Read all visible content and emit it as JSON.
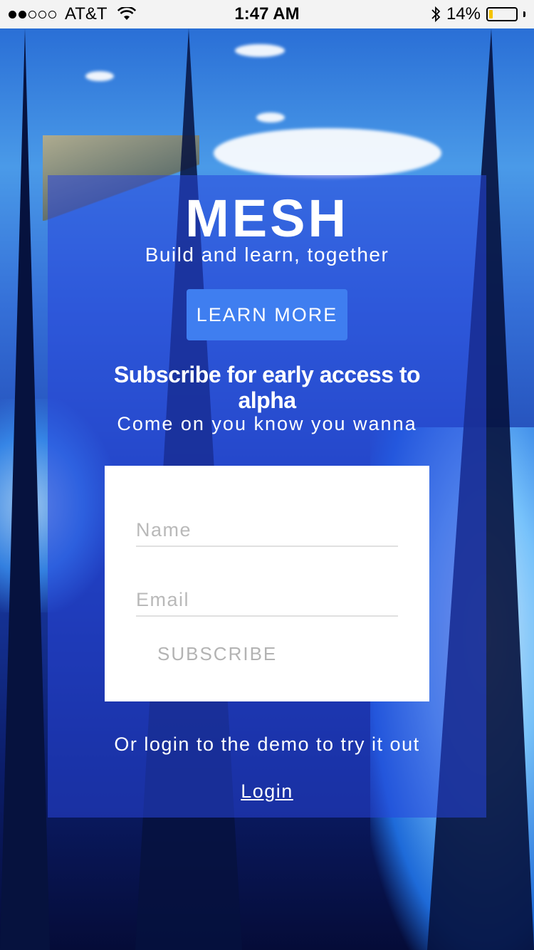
{
  "status_bar": {
    "signal_dots_filled": 2,
    "signal_dots_total": 5,
    "carrier": "AT&T",
    "time": "1:47 AM",
    "battery_percent": "14%",
    "battery_level": 0.14,
    "icons": [
      "wifi-icon",
      "bluetooth-icon",
      "battery-icon"
    ]
  },
  "hero": {
    "brand": "MESH",
    "tagline": "Build and learn, together",
    "learn_more_label": "LEARN MORE"
  },
  "subscribe": {
    "title": "Subscribe for early access to alpha",
    "subtitle": "Come on you know you wanna",
    "name_placeholder": "Name",
    "email_placeholder": "Email",
    "button_label": "SUBSCRIBE"
  },
  "demo": {
    "text": "Or login to the demo to try it out",
    "login_label": "Login"
  },
  "colors": {
    "card_overlay": "#2846dc",
    "button_blue": "#3f7ef0",
    "battery_fill": "#f5c400"
  }
}
